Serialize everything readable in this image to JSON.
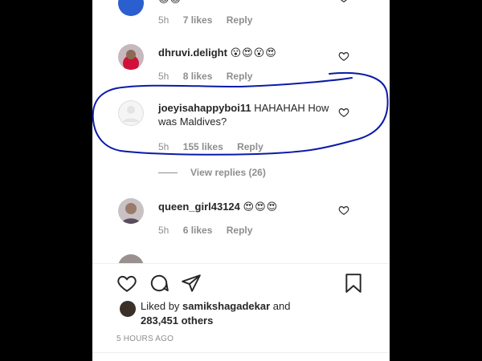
{
  "comments": [
    {
      "username": "",
      "text": "",
      "time": "5h",
      "likes": "7 likes",
      "reply": "Reply"
    },
    {
      "username": "dhruvi.delight",
      "text": "😮😍😮😍",
      "time": "5h",
      "likes": "8 likes",
      "reply": "Reply"
    },
    {
      "username": "joeyisahappyboi11",
      "text": "HAHAHAH How was Maldives?",
      "time": "5h",
      "likes": "155 likes",
      "reply": "Reply"
    },
    {
      "username": "queen_girl43124",
      "text": "😍😍😍",
      "time": "5h",
      "likes": "6 likes",
      "reply": "Reply"
    }
  ],
  "view_replies": "View replies (26)",
  "liked_by": {
    "prefix": "Liked by",
    "user": "samikshagadekar",
    "connector": "and",
    "others": "283,451 others"
  },
  "timestamp": "5 HOURS AGO",
  "icons": [
    "heart-icon",
    "comment-icon",
    "share-icon",
    "bookmark-icon"
  ],
  "annotation_color": "#0a1aa8"
}
